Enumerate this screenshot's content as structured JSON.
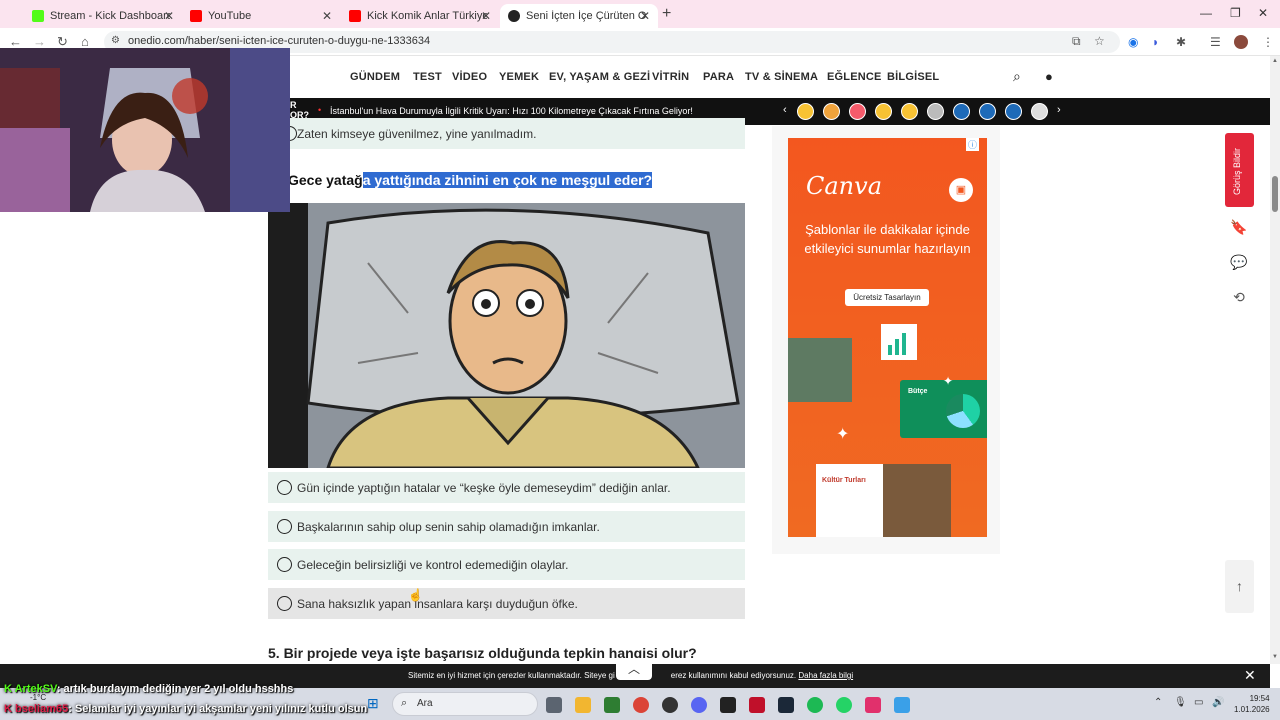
{
  "browser": {
    "tabs": [
      {
        "label": "Stream - Kick Dashboard",
        "color": "#53fc18",
        "active": false
      },
      {
        "label": "YouTube",
        "color": "#ff0000",
        "active": false
      },
      {
        "label": "Kick Komik Anlar Türkiye Rewin",
        "color": "#ff0000",
        "active": false
      },
      {
        "label": "Seni İçten İçe Çürüten O Duygu",
        "color": "#222222",
        "active": true
      }
    ],
    "url": "onedio.com/haber/seni-icten-ice-curuten-o-duygu-ne-1333634"
  },
  "site": {
    "nav": [
      "GÜNDEM",
      "TEST",
      "VİDEO",
      "YEMEK",
      "EV, YAŞAM & GEZİ",
      "VİTRİN",
      "PARA",
      "TV & SİNEMA",
      "EĞLENCE",
      "BİLGİSEL"
    ],
    "ticker_label_1": "R",
    "ticker_label_2": "OR?",
    "ticker_text": "İstanbul'un Hava Durumuyla İlgili Kritik Uyarı: Hızı 100 Kilometreye Çıkacak Fırtına Geliyor!",
    "reaction_colors": [
      "#f7c234",
      "#f0a33c",
      "#f55b6b",
      "#f7c234",
      "#f7c234",
      "#bbbbbb",
      "#1e6ab8",
      "#1e6ab8",
      "#1e6ab8",
      "#dddddd"
    ]
  },
  "article": {
    "prev_option": "Zaten kimseye güvenilmez, yine yanılmadım.",
    "question_plain": "Gece yatağ",
    "question_highlight": "a yattığında zihnini en çok ne meşgul eder?",
    "options": [
      "Gün içinde yaptığın hatalar ve “keşke öyle demeseydim” dediğin anlar.",
      "Başkalarının sahip olup senin sahip olamadığın imkanlar.",
      "Geleceğin belirsizliği ve kontrol edemediğin olaylar.",
      "Sana haksızlık yapan insanlara karşı duyduğun öfke."
    ],
    "next_question": "5. Bir projede veya işte başarısız olduğunda tepkin hangisi olur?"
  },
  "ad": {
    "brand": "Canva",
    "headline": "Şablonlar ile dakikalar içinde etkileyici sunumlar hazırlayın",
    "cta": "Ücretsiz Tasarlayın",
    "card_title": "Kültür Turları",
    "card_label": "Bütçe"
  },
  "side": {
    "feedback": "Görüş Bildir"
  },
  "cookie": {
    "text_a": "Sitemiz en iyi hizmet için çerezler kullanmaktadır. Siteye gi",
    "text_b": "erez kullanımını kabul ediyorsunuz.",
    "link": "Daha fazla bilgi"
  },
  "chat": [
    {
      "user": "ArtekSV",
      "message": ": artık burdayım dediğin yer 2 yıl oldu hsshhs",
      "color": "#53fc18"
    },
    {
      "user": "bseliam65",
      "message": ": Selamlar iyi yayınlar iyi akşamlar yeni yılınız kutlu olsun",
      "color": "#e11d48"
    }
  ],
  "taskbar": {
    "search": "Ara",
    "weather": "-1°C",
    "time": "19:54",
    "date": "1.01.2026"
  }
}
